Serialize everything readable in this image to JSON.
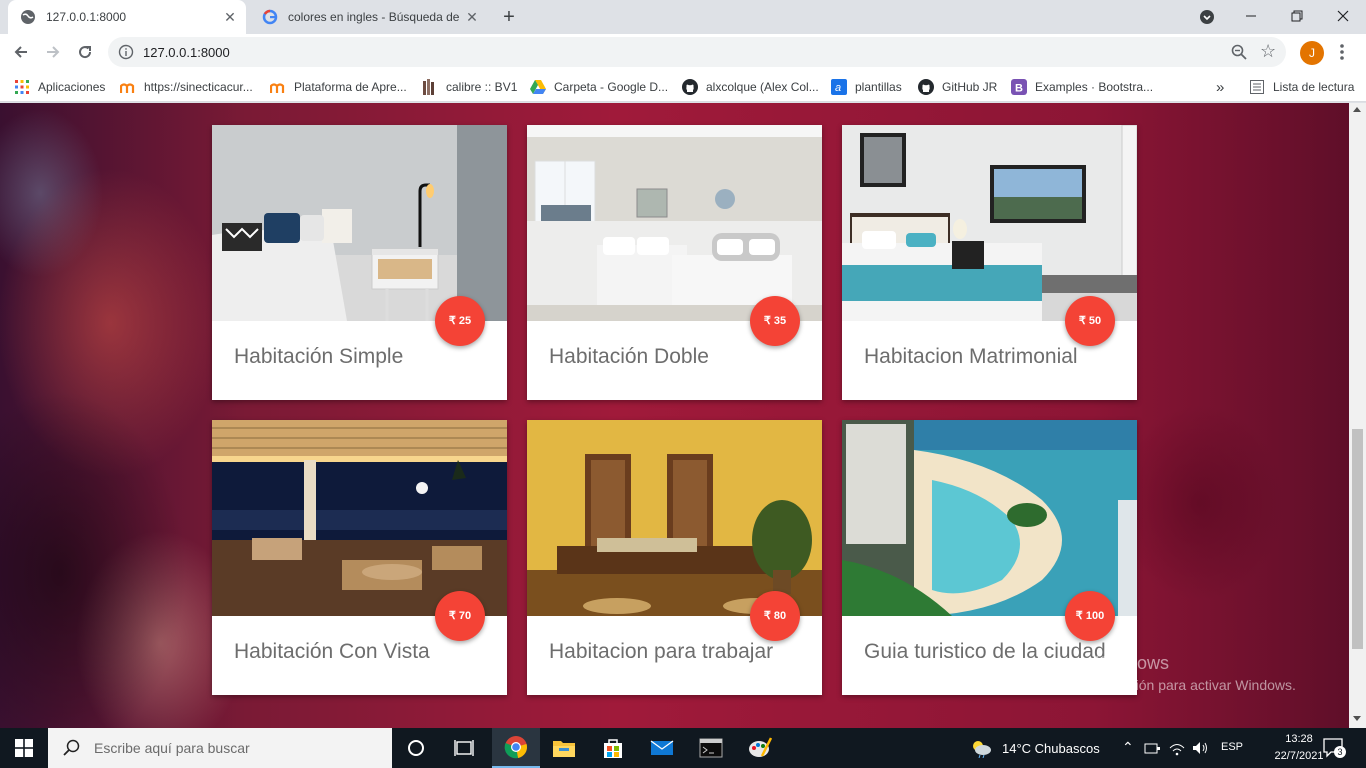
{
  "browser": {
    "tabs": [
      {
        "title": "127.0.0.1:8000",
        "active": true
      },
      {
        "title": "colores en ingles - Búsqueda de Google",
        "active": false
      }
    ],
    "new_tab_label": "+",
    "address": "127.0.0.1:8000",
    "profile_initial": "J",
    "bookmarks": [
      {
        "label": "Aplicaciones",
        "icon": "apps-grid-icon"
      },
      {
        "label": "https://sinecticacur...",
        "icon": "moodle-icon"
      },
      {
        "label": "Plataforma de Apre...",
        "icon": "moodle-icon"
      },
      {
        "label": "calibre :: BV1",
        "icon": "books-icon"
      },
      {
        "label": "Carpeta - Google D...",
        "icon": "google-drive-icon"
      },
      {
        "label": "alxcolque (Alex Col...",
        "icon": "github-icon"
      },
      {
        "label": "plantillas",
        "icon": "template-icon"
      },
      {
        "label": "GitHub JR",
        "icon": "github-icon"
      },
      {
        "label": "Examples · Bootstra...",
        "icon": "bootstrap-icon"
      }
    ],
    "bookmarks_overflow": "»",
    "reading_list_label": "Lista de lectura"
  },
  "page": {
    "cards": [
      {
        "title": "Habitación Simple",
        "price": "₹ 25",
        "image": "bedroom-simple"
      },
      {
        "title": "Habitación Doble",
        "price": "₹ 35",
        "image": "bedroom-double"
      },
      {
        "title": "Habitacion Matrimonial",
        "price": "₹ 50",
        "image": "bedroom-master"
      },
      {
        "title": "Habitación Con Vista",
        "price": "₹ 70",
        "image": "terrace-night-view"
      },
      {
        "title": "Habitacion para trabajar",
        "price": "₹ 80",
        "image": "work-room"
      },
      {
        "title": "Guia turistico de la ciudad",
        "price": "₹ 100",
        "image": "beach-lagoon"
      }
    ],
    "watermark_title": "Activar Windows",
    "watermark_subtitle": "Ve a Configuración para activar Windows."
  },
  "taskbar": {
    "search_placeholder": "Escribe aquí para buscar",
    "apps": [
      "cortana-icon",
      "task-view-icon",
      "chrome-icon",
      "file-explorer-icon",
      "store-icon",
      "mail-icon",
      "terminal-icon",
      "paint-icon"
    ],
    "weather": "14°C  Chubascos",
    "language": "ESP",
    "time": "13:28",
    "date": "22/7/2021",
    "notifications_count": "3"
  }
}
